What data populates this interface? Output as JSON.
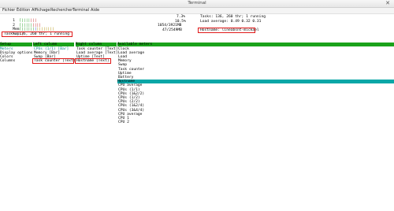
{
  "window": {
    "title": "Terminal"
  },
  "menu": [
    "Fichier",
    "Édition",
    "Affichage",
    "Rechercher",
    "Terminal",
    "Aide"
  ],
  "meters": {
    "cpu1": {
      "label": "1",
      "value": "7.3%",
      "percent": 7.3
    },
    "cpu2": {
      "label": "2",
      "value": "10.5%",
      "percent": 10.5
    },
    "mem": {
      "label": "Mem",
      "value": "1054/3921MB",
      "percent": 27
    },
    "swp": {
      "label": "Swp",
      "value": "47/2549MB",
      "percent": 2
    }
  },
  "tasks_line": "Tasks: 136, 260 thr; 1 running",
  "load_line": "Load average: 0.49 0.32 0.31",
  "hostname_line": "Hostname: lineabsnt-mickael",
  "left_task_preview": "Tasks: 136, 260 thr; 1 running",
  "setup": {
    "headers": {
      "setup": "Setup",
      "left": "Left column",
      "right": "Right column",
      "available": "Available meters"
    },
    "categories": [
      "Meters",
      "Display options",
      "Colors",
      "Columns"
    ],
    "left_column": [
      "CPUs (1/1) [Bar]",
      "Memory [Bar]",
      "Swap [Bar]",
      "Task counter [Text]"
    ],
    "right_column": [
      "Task counter [Text]",
      "Load average [Text]",
      "Uptime [Text]",
      "Hostname [Text]"
    ],
    "available": [
      "Clock",
      "Load average",
      "Load",
      "Memory",
      "Swap",
      "Task counter",
      "Uptime",
      "Battery",
      "Hostname",
      "CPU average",
      "CPUs (1/1)",
      "CPUs (1&2/2)",
      "CPUs (1/2)",
      "CPUs (2/2)",
      "CPUs (1&2/4)",
      "CPUs (3&4/4)",
      "CPU average",
      "CPU 1",
      "CPU 2"
    ]
  },
  "colors": {
    "header_green": "#1aa21a",
    "selection_cyan": "#0aa7a7",
    "highlight_red": "#e01818"
  }
}
